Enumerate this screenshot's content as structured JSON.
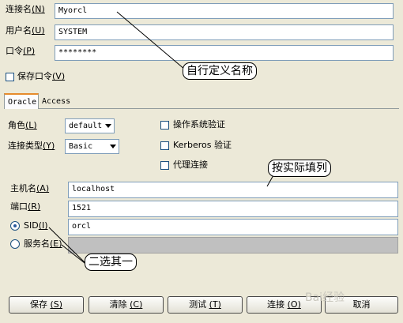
{
  "connection": {
    "name_label": "连接名",
    "name_key": "(N)",
    "name_value": "Myorcl",
    "user_label": "用户名",
    "user_key": "(U)",
    "user_value": "SYSTEM",
    "password_label": "口令",
    "password_key": "(P)",
    "password_value": "********",
    "save_password_label": "保存口令",
    "save_password_key": "(V)",
    "save_password_checked": false
  },
  "tabs": [
    {
      "label": "Oracle",
      "active": true
    },
    {
      "label": "Access",
      "active": false
    }
  ],
  "oracle": {
    "role_label": "角色",
    "role_key": "(L)",
    "role_value": "default",
    "conn_type_label": "连接类型",
    "conn_type_key": "(Y)",
    "conn_type_value": "Basic",
    "os_auth_label": "操作系统验证",
    "kerberos_label": "Kerberos 验证",
    "proxy_label": "代理连接",
    "host_label": "主机名",
    "host_key": "(A)",
    "host_value": "localhost",
    "port_label": "端口",
    "port_key": "(R)",
    "port_value": "1521",
    "sid_label": "SID",
    "sid_key": "(I)",
    "sid_value": "orcl",
    "sid_selected": true,
    "service_label": "服务名",
    "service_key": "(E)",
    "service_value": ""
  },
  "buttons": {
    "save": "保存",
    "save_key": "(S)",
    "clear": "清除",
    "clear_key": "(C)",
    "test": "测试",
    "test_key": "(T)",
    "connect": "连接",
    "connect_key": "(O)",
    "cancel": "取消"
  },
  "annotations": {
    "custom_name": "自行定义名称",
    "fill_actual": "按实际填列",
    "choose_one": "二选其一"
  },
  "watermark": "Bai经验"
}
